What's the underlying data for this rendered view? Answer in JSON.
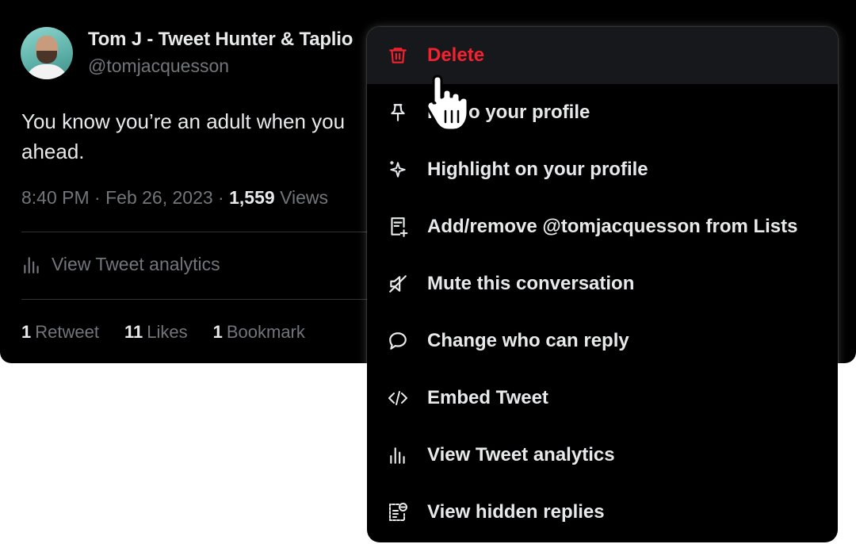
{
  "tweet": {
    "display_name": "Tom J - Tweet Hunter & Taplio",
    "handle": "@tomjacquesson",
    "text_line1": "You know you’re an adult when you",
    "text_line2": "ahead.",
    "time": "8:40 PM",
    "date": "Feb 26, 2023",
    "views_count": "1,559",
    "views_label": "Views",
    "analytics_label": "View Tweet analytics",
    "retweets_count": "1",
    "retweets_label": "Retweet",
    "likes_count": "11",
    "likes_label": "Likes",
    "bookmarks_count": "1",
    "bookmarks_label": "Bookmark"
  },
  "menu": {
    "items": [
      {
        "label": "Delete",
        "icon": "trash-icon"
      },
      {
        "label": "Pin to your profile",
        "icon": "pin-icon"
      },
      {
        "label": "Highlight on your profile",
        "icon": "sparkle-icon"
      },
      {
        "label": "Add/remove @tomjacquesson from Lists",
        "icon": "list-add-icon"
      },
      {
        "label": "Mute this conversation",
        "icon": "mute-icon"
      },
      {
        "label": "Change who can reply",
        "icon": "speech-bubble-icon"
      },
      {
        "label": "Embed Tweet",
        "icon": "code-icon"
      },
      {
        "label": "View Tweet analytics",
        "icon": "bar-chart-icon"
      },
      {
        "label": "View hidden replies",
        "icon": "hidden-replies-icon"
      }
    ]
  },
  "colors": {
    "danger": "#f4212e",
    "text_primary": "#e7e9ea",
    "text_secondary": "#71767b",
    "background": "#000000"
  }
}
